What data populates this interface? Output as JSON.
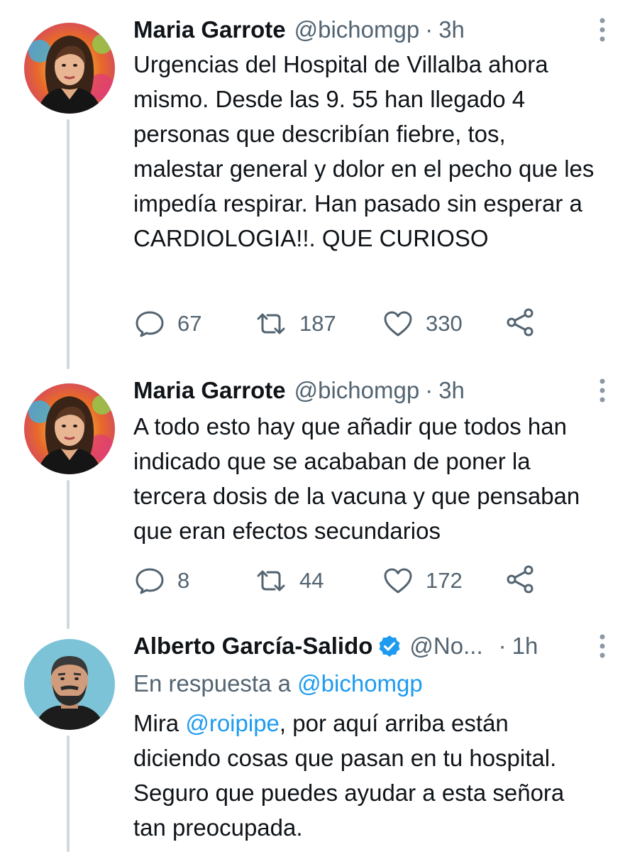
{
  "tweets": [
    {
      "author": "Maria Garrote",
      "handle": "@bichomgp",
      "time": "3h",
      "text": "Urgencias del Hospital de Villalba ahora mismo. Desde las 9. 55 han llegado 4 personas que describían fiebre, tos, malestar general y dolor en el pecho que les impedía respirar. Han pasado sin esperar a CARDIOLOGIA!!. QUE CURIOSO",
      "replies": "67",
      "retweets": "187",
      "likes": "330"
    },
    {
      "author": "Maria Garrote",
      "handle": "@bichomgp",
      "time": "3h",
      "text": "A todo esto hay que añadir que todos han indicado que se acababan de poner la tercera dosis de la vacuna y que pensaban que eran efectos secundarios",
      "replies": "8",
      "retweets": "44",
      "likes": "172"
    },
    {
      "author": "Alberto García-Salido",
      "handle": "@No...",
      "time": "1h",
      "reply_prefix": "En respuesta a",
      "reply_to": "@bichomgp",
      "text_before": "Mira",
      "mention": "@roipipe",
      "text_after": ", por aquí arriba están diciendo cosas que pasan en tu hospital. Seguro que puedes ayudar a esta señora tan preocupada."
    }
  ],
  "icons": {
    "reply": "reply-icon",
    "retweet": "retweet-icon",
    "like": "heart-icon",
    "share": "share-icon",
    "more": "more-vertical-icon",
    "verified": "verified-badge-icon"
  },
  "colors": {
    "text": "#0f1419",
    "secondary": "#536471",
    "link": "#1d9bf0",
    "thread_line": "#cfd9de"
  }
}
